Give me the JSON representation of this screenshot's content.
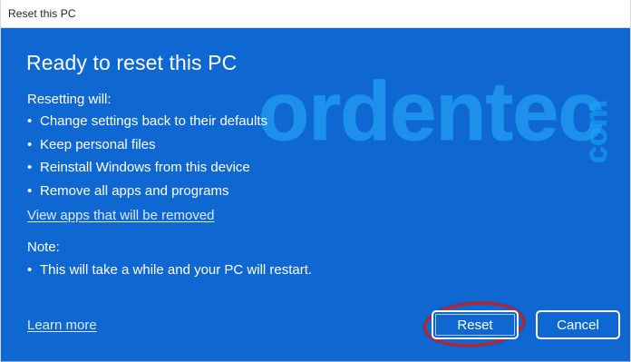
{
  "window": {
    "title": "Reset this PC"
  },
  "dialog": {
    "heading": "Ready to reset this PC",
    "resetting_will_label": "Resetting will:",
    "resetting_items": [
      "Change settings back to their defaults",
      "Keep personal files",
      "Reinstall Windows from this device",
      "Remove all apps and programs"
    ],
    "view_apps_link": "View apps that will be removed",
    "note_label": "Note:",
    "note_item": "This will take a while and your PC will restart.",
    "learn_more_link": "Learn more",
    "reset_button": "Reset",
    "cancel_button": "Cancel"
  },
  "watermark": {
    "main": "ordentec",
    "side": "com"
  },
  "colors": {
    "dialog_blue": "#0f67d1",
    "white": "#ffffff",
    "link": "#dceaff",
    "highlight_red": "#c51f22"
  }
}
